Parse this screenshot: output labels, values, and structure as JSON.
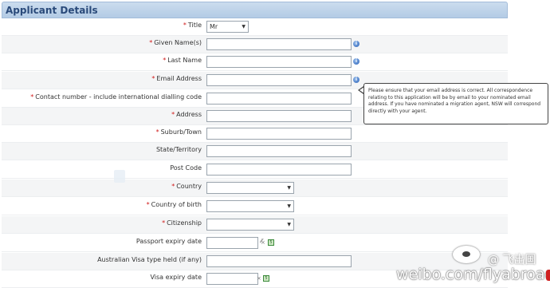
{
  "section": {
    "title": "Applicant Details"
  },
  "fields": {
    "title": {
      "label": "Title",
      "value": "Mr"
    },
    "given_names": {
      "label": "Given Name(s)"
    },
    "last_name": {
      "label": "Last Name"
    },
    "email": {
      "label": "Email Address"
    },
    "contact": {
      "label": "Contact number - include international dialling code"
    },
    "address": {
      "label": "Address"
    },
    "suburb": {
      "label": "Suburb/Town"
    },
    "state": {
      "label": "State/Territory"
    },
    "postcode": {
      "label": "Post Code"
    },
    "country": {
      "label": "Country"
    },
    "country_of_birth": {
      "label": "Country of birth"
    },
    "citizenship": {
      "label": "Citizenship"
    },
    "passport_expiry": {
      "label": "Passport expiry date"
    },
    "visa_type": {
      "label": "Australian Visa type held (if any)"
    },
    "visa_expiry": {
      "label": "Visa expiry date"
    }
  },
  "required_marker": "*",
  "tooltip": {
    "text": "Please ensure that your email address is correct. All correspondence relating to this application will be by email to your nominated email address. If you have nominated a migration agent, NSW will correspond directly with your agent."
  },
  "watermark": {
    "text": "weibo.com/flyabroad",
    "handle": "@ 飞出国"
  },
  "colors": {
    "header_bg": "#b3cbe5",
    "header_text": "#2a4a7a",
    "required": "#d01818",
    "info_icon": "#2e64b8"
  },
  "icons": {
    "info": "info-circle-icon",
    "calendar": "calendar-icon",
    "clear": "clear-x-icon"
  }
}
